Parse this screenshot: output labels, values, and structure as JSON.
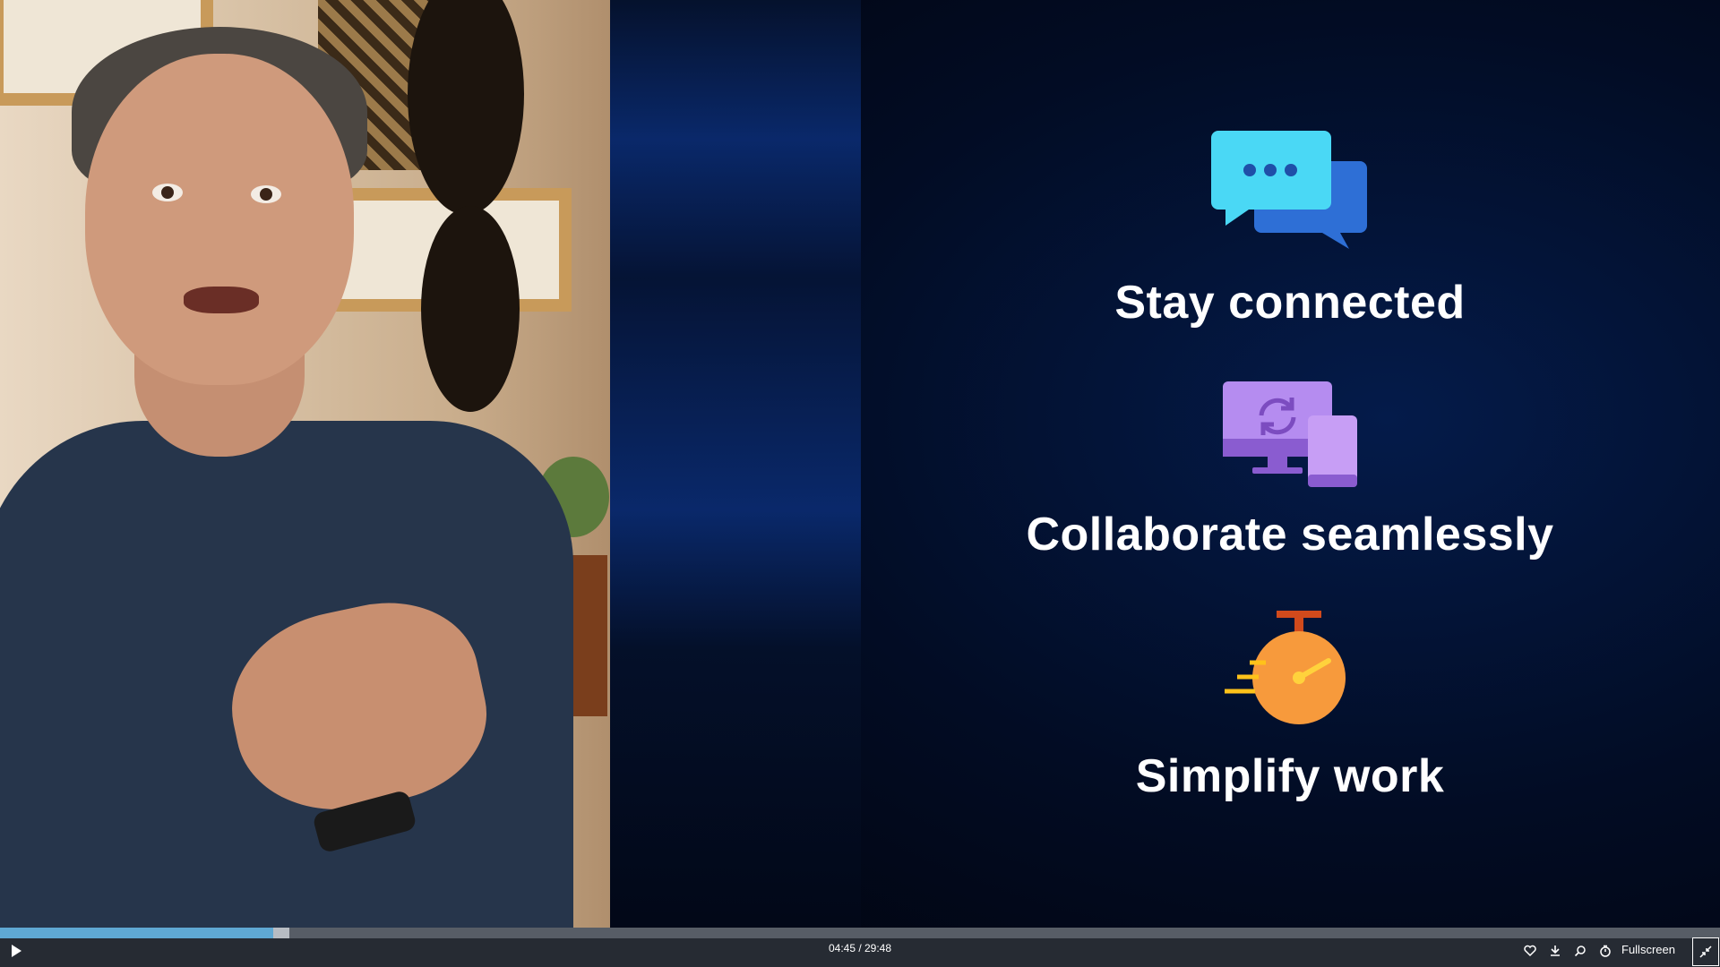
{
  "slide": {
    "features": [
      {
        "label": "Stay connected",
        "icon": "chat-bubbles-icon"
      },
      {
        "label": "Collaborate seamlessly",
        "icon": "sync-devices-icon"
      },
      {
        "label": "Simplify work",
        "icon": "stopwatch-icon"
      }
    ]
  },
  "player": {
    "time_display": "04:45 / 29:48",
    "played_fraction": 0.159,
    "buffered_fraction": 0.168,
    "fullscreen_label": "Fullscreen",
    "icons": [
      "play-icon",
      "heart-icon",
      "download-icon",
      "search-icon",
      "timer-icon",
      "exit-fullscreen-icon"
    ]
  },
  "colors": {
    "progress": "#5fa8d3",
    "chat_front": "#4ad8f5",
    "chat_back": "#2e6fd6",
    "monitor": "#b58cf0",
    "stopwatch": "#f79a3c"
  }
}
